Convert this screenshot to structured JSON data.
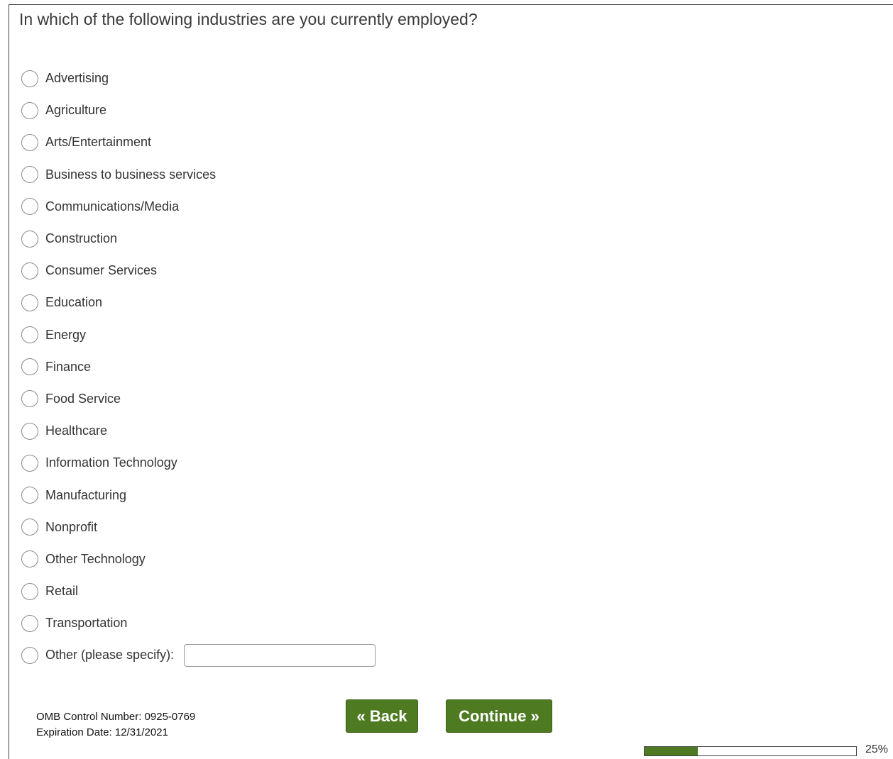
{
  "question": "In which of the following industries are you currently employed?",
  "options": [
    {
      "label": "Advertising"
    },
    {
      "label": "Agriculture"
    },
    {
      "label": "Arts/Entertainment"
    },
    {
      "label": "Business to business services"
    },
    {
      "label": "Communications/Media"
    },
    {
      "label": "Construction"
    },
    {
      "label": "Consumer Services"
    },
    {
      "label": "Education"
    },
    {
      "label": "Energy"
    },
    {
      "label": "Finance"
    },
    {
      "label": "Food Service"
    },
    {
      "label": "Healthcare"
    },
    {
      "label": "Information Technology"
    },
    {
      "label": "Manufacturing"
    },
    {
      "label": "Nonprofit"
    },
    {
      "label": "Other Technology"
    },
    {
      "label": "Retail"
    },
    {
      "label": "Transportation"
    },
    {
      "label": "Other (please specify):"
    }
  ],
  "other_input": {
    "value": "",
    "placeholder": ""
  },
  "footer": {
    "omb_control": "OMB Control Number: 0925-0769",
    "expiration": "Expiration Date: 12/31/2021"
  },
  "buttons": {
    "back": "« Back",
    "continue": "Continue »"
  },
  "progress": {
    "fraction": 0.25,
    "label": "25%"
  },
  "colors": {
    "accent": "#4e7a22",
    "border": "#444444",
    "text": "#333333"
  }
}
